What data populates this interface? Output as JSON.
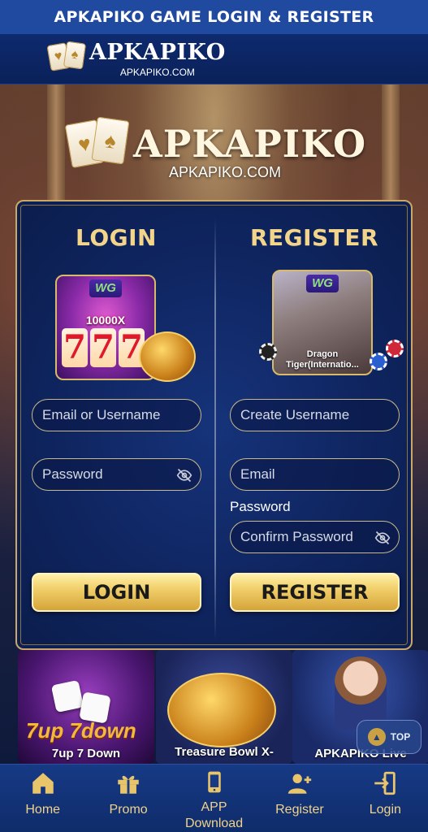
{
  "topbar": {
    "title": "APKAPIKO GAME LOGIN & REGISTER"
  },
  "header": {
    "brand": "APKAPIKO",
    "domain": "APKAPIKO.COM"
  },
  "hero": {
    "brand": "APKAPIKO",
    "domain": "APKAPIKO.COM"
  },
  "login": {
    "title": "LOGIN",
    "game": {
      "badge": "WG",
      "jackpot": "10000X",
      "reels": [
        "7",
        "7",
        "7"
      ]
    },
    "username_placeholder": "Email or Username",
    "password_placeholder": "Password",
    "button": "LOGIN"
  },
  "register": {
    "title": "REGISTER",
    "game": {
      "badge": "WG",
      "caption": "Dragon Tiger(Internatio..."
    },
    "username_placeholder": "Create Username",
    "email_placeholder": "Email",
    "password_label": "Password",
    "confirm_placeholder": "Confirm Password",
    "button": "REGISTER"
  },
  "games": [
    {
      "title": "7up 7down",
      "subtitle": "7up 7 Down"
    },
    {
      "title": "Treasure Bowl X-"
    },
    {
      "title": "APKAPIKO Live"
    }
  ],
  "top_button": {
    "label": "TOP"
  },
  "nav": [
    {
      "label": "Home",
      "icon": "home-icon"
    },
    {
      "label": "Promo",
      "icon": "gift-icon"
    },
    {
      "label": "APP Download",
      "icon": "phone-icon"
    },
    {
      "label": "Register",
      "icon": "add-user-icon"
    },
    {
      "label": "Login",
      "icon": "login-icon"
    }
  ],
  "colors": {
    "accent_gold": "#f2d48a",
    "panel_blue": "#0f2560",
    "topbar_blue": "#1f4aa0"
  }
}
